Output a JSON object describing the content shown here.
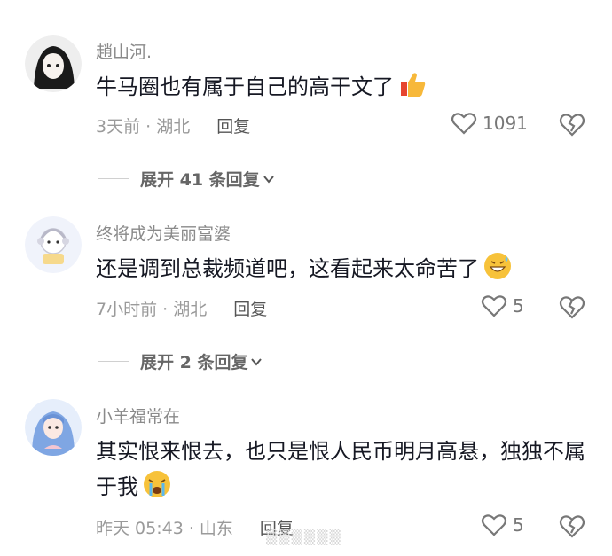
{
  "comments": [
    {
      "username": "趙山河.",
      "text": "牛马圈也有属于自己的高干文了",
      "emoji": "thumbs-up-emoji",
      "meta": "3天前 · 湖北",
      "reply_label": "回复",
      "likes": "1091",
      "expand_label": "展开 41 条回复"
    },
    {
      "username": "终将成为美丽富婆",
      "text": "还是调到总裁频道吧，这看起来太命苦了",
      "emoji": "grinning-sweat-emoji",
      "meta": "7小时前 · 湖北",
      "reply_label": "回复",
      "likes": "5",
      "expand_label": "展开 2 条回复"
    },
    {
      "username": "小羊福常在",
      "text": "其实恨来恨去，也只是恨人民币明月高悬，独独不属于我",
      "emoji": "crying-emoji",
      "meta": "昨天 05:43 · 山东",
      "reply_label": "回复",
      "likes": "5"
    }
  ],
  "colors": {
    "text": "#161823",
    "muted": "#8a8a8a",
    "emoji_yellow": "#f7b83a"
  }
}
